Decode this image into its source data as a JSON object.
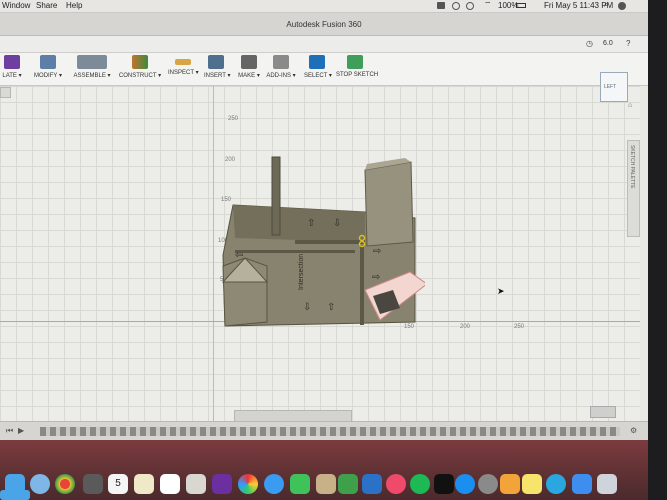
{
  "menubar": {
    "items": [
      "Window",
      "Share",
      "Help"
    ],
    "clock": "Fri May 5  11:43 PM",
    "battery": "100%"
  },
  "window": {
    "title": "Autodesk Fusion 360",
    "zoom": "6.0"
  },
  "ribbon": {
    "groups": [
      "LATE ▾",
      "MODIFY ▾",
      "ASSEMBLE ▾",
      "CONSTRUCT ▾",
      "INSPECT ▾",
      "INSERT ▾",
      "MAKE ▾",
      "ADD-INS ▾",
      "SELECT ▾",
      "STOP SKETCH"
    ]
  },
  "viewcube": {
    "label": "LEFT"
  },
  "axis_ticks": {
    "y": [
      "250",
      "200",
      "150",
      "100",
      "50"
    ],
    "x": [
      "150",
      "200",
      "250"
    ]
  },
  "panel": {
    "label": "SKETCH PALETTE"
  },
  "model": {
    "label": "Intersection"
  },
  "colors": {
    "accent": "#1e6fb8",
    "dock": "#6b3236"
  },
  "dock": {
    "icons": [
      "finder-icon",
      "launchpad-icon",
      "safari-icon",
      "chrome-icon",
      "mail-icon",
      "calendar-icon",
      "notes-icon",
      "reminders-icon",
      "photos-icon",
      "imovie-icon",
      "pinwheel-icon",
      "facetime-icon",
      "messages-icon",
      "contacts-icon",
      "numbers-icon",
      "keynote-icon",
      "music-icon",
      "spotify-icon",
      "appstore-icon",
      "preferences-icon",
      "fusion-icon",
      "stickies-icon",
      "arc-icon",
      "downloads-icon",
      "trash-icon"
    ],
    "calendar_day": "5"
  }
}
